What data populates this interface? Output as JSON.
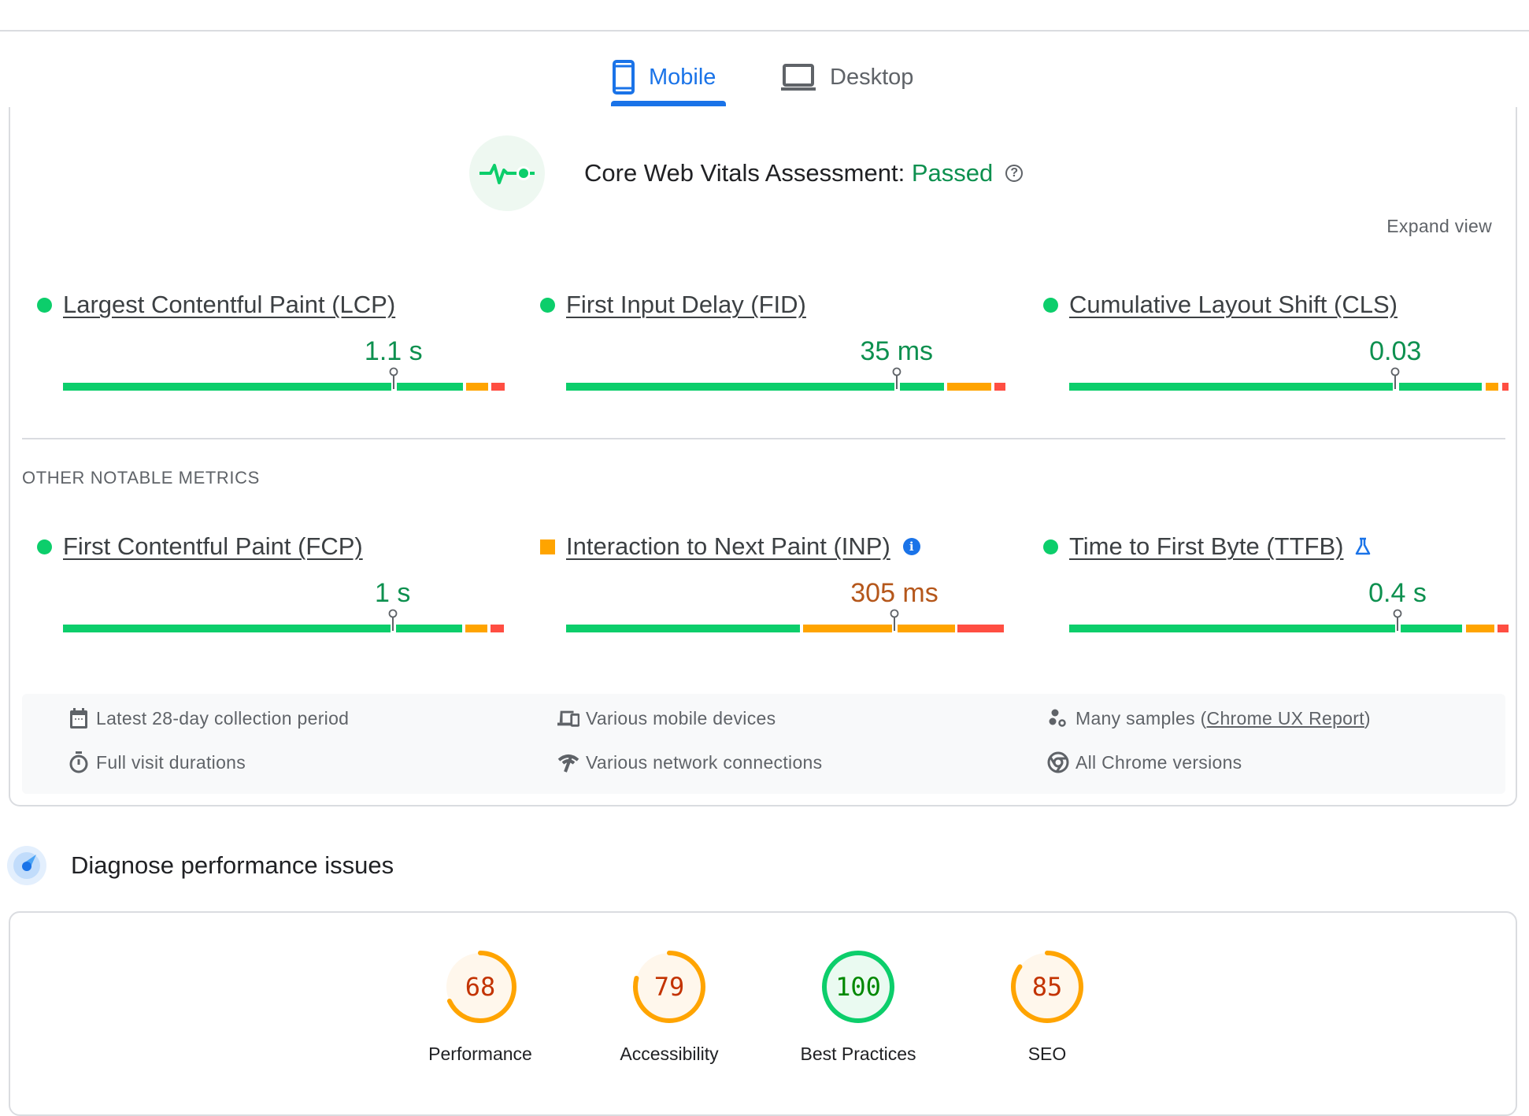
{
  "tabs": [
    {
      "label": "Mobile",
      "icon": "smartphone-icon",
      "active": true
    },
    {
      "label": "Desktop",
      "icon": "laptop-icon",
      "active": false
    }
  ],
  "cwv": {
    "title": "Core Web Vitals Assessment: ",
    "status": "Passed",
    "help": "?",
    "expand_label": "Expand view"
  },
  "core_metrics": [
    {
      "name": "Largest Contentful Paint (LCP)",
      "value": "1.1 s",
      "rating": "good",
      "distribution": [
        0.75,
        0.15,
        0.05,
        0.03
      ],
      "marker": 0.755
    },
    {
      "name": "First Input Delay (FID)",
      "value": "35 ms",
      "rating": "good",
      "distribution": [
        0.75,
        0.1,
        0.1,
        0.025
      ],
      "marker": 0.755
    },
    {
      "name": "Cumulative Layout Shift (CLS)",
      "value": "0.03",
      "rating": "good",
      "distribution": [
        0.74,
        0.19,
        0.03,
        0.015
      ],
      "marker": 0.745
    }
  ],
  "other_label": "OTHER NOTABLE METRICS",
  "other_metrics": [
    {
      "name": "First Contentful Paint (FCP)",
      "value": "1 s",
      "rating": "good",
      "distribution": [
        0.745,
        0.15,
        0.05,
        0.03
      ],
      "marker": 0.753,
      "badge": null
    },
    {
      "name": "Interaction to Next Paint (INP)",
      "value": "305 ms",
      "rating": "avg",
      "distribution": [
        0.535,
        0.2,
        0.13,
        0.1
      ],
      "marker": 0.75,
      "badge": "info"
    },
    {
      "name": "Time to First Byte (TTFB)",
      "value": "0.4 s",
      "rating": "good",
      "distribution": [
        0.74,
        0.14,
        0.065,
        0.025
      ],
      "marker": 0.75,
      "badge": "experimental"
    }
  ],
  "footer": {
    "items": [
      {
        "icon": "calendar-icon",
        "text": "Latest 28-day collection period"
      },
      {
        "icon": "devices-icon",
        "text": "Various mobile devices"
      },
      {
        "icon": "samples-icon",
        "text": "Many samples (",
        "link": "Chrome UX Report",
        "suffix": ")"
      },
      {
        "icon": "stopwatch-icon",
        "text": "Full visit durations"
      },
      {
        "icon": "network-icon",
        "text": "Various network connections"
      },
      {
        "icon": "chrome-icon",
        "text": "All Chrome versions"
      }
    ]
  },
  "diagnose": {
    "title": "Diagnose performance issues"
  },
  "scores": [
    {
      "label": "Performance",
      "score": "68",
      "value": 68,
      "rating": "avg"
    },
    {
      "label": "Accessibility",
      "score": "79",
      "value": 79,
      "rating": "avg"
    },
    {
      "label": "Best Practices",
      "score": "100",
      "value": 100,
      "rating": "good"
    },
    {
      "label": "SEO",
      "score": "85",
      "value": 85,
      "rating": "avg"
    }
  ],
  "colors": {
    "accent": "#1a73e8",
    "good": "#0cce6b",
    "good_text": "#0d904f",
    "average": "#ffa400",
    "average_text": "#b5571b",
    "poor": "#ff4e42",
    "score_avg_text": "#c33300",
    "score_good_text": "#008800"
  }
}
